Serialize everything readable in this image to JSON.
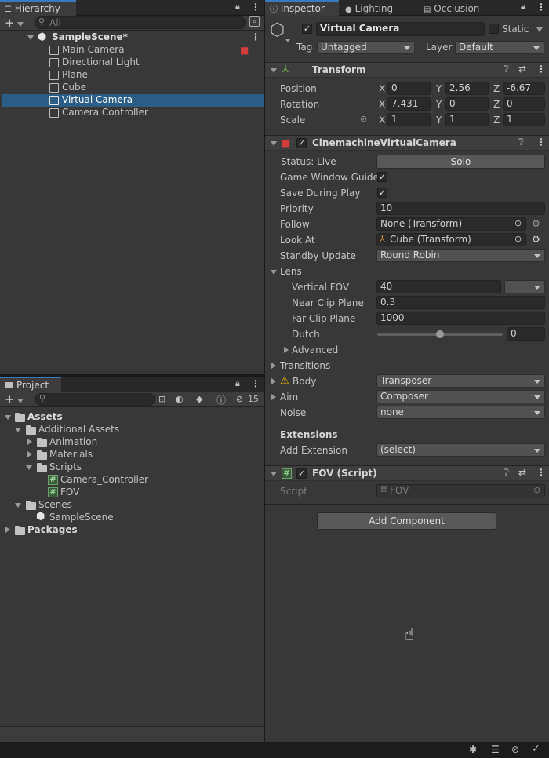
{
  "hierarchy": {
    "tab_label": "Hierarchy",
    "search_placeholder": "All",
    "scene_name": "SampleScene*",
    "items": [
      {
        "label": "Main Camera"
      },
      {
        "label": "Directional Light"
      },
      {
        "label": "Plane"
      },
      {
        "label": "Cube"
      },
      {
        "label": "Virtual Camera"
      },
      {
        "label": "Camera Controller"
      }
    ]
  },
  "project": {
    "tab_label": "Project",
    "hidden_count": "15",
    "tree": {
      "assets": "Assets",
      "additional_assets": "Additional Assets",
      "animation": "Animation",
      "materials": "Materials",
      "scripts": "Scripts",
      "camera_controller": "Camera_Controller",
      "fov": "FOV",
      "scenes": "Scenes",
      "sample_scene": "SampleScene",
      "packages": "Packages"
    }
  },
  "inspector": {
    "tabs": [
      "Inspector",
      "Lighting",
      "Occlusion"
    ],
    "object_name": "Virtual Camera",
    "static_label": "Static",
    "tag_label": "Tag",
    "tag_value": "Untagged",
    "layer_label": "Layer",
    "layer_value": "Default",
    "transform": {
      "title": "Transform",
      "position_label": "Position",
      "rotation_label": "Rotation",
      "scale_label": "Scale",
      "position": {
        "x": "0",
        "y": "2.56",
        "z": "-6.67"
      },
      "rotation": {
        "x": "7.431",
        "y": "0",
        "z": "0"
      },
      "scale": {
        "x": "1",
        "y": "1",
        "z": "1"
      },
      "axis_x": "X",
      "axis_y": "Y",
      "axis_z": "Z"
    },
    "vcam": {
      "title": "CinemachineVirtualCamera",
      "status": "Status: Live",
      "solo": "Solo",
      "game_window_guides": "Game Window Guides",
      "save_during_play": "Save During Play",
      "priority_label": "Priority",
      "priority_value": "10",
      "follow_label": "Follow",
      "follow_value": "None (Transform)",
      "look_at_label": "Look At",
      "look_at_value": "Cube (Transform)",
      "standby_label": "Standby Update",
      "standby_value": "Round Robin",
      "lens_label": "Lens",
      "vfov_label": "Vertical FOV",
      "vfov_value": "40",
      "near_label": "Near Clip Plane",
      "near_value": "0.3",
      "far_label": "Far Clip Plane",
      "far_value": "1000",
      "dutch_label": "Dutch",
      "dutch_value": "0",
      "dutch_slider_fraction": 0.5,
      "advanced_label": "Advanced",
      "transitions_label": "Transitions",
      "body_label": "Body",
      "body_value": "Transposer",
      "aim_label": "Aim",
      "aim_value": "Composer",
      "noise_label": "Noise",
      "noise_value": "none",
      "extensions_label": "Extensions",
      "add_extension_label": "Add Extension",
      "add_extension_value": "(select)"
    },
    "fov_script": {
      "title": "FOV (Script)",
      "script_label": "Script",
      "script_value": "FOV"
    },
    "add_component": "Add Component"
  },
  "colors": {
    "selection": "#2c5d87",
    "accent": "#3a79bb",
    "warning": "#f0b400"
  }
}
